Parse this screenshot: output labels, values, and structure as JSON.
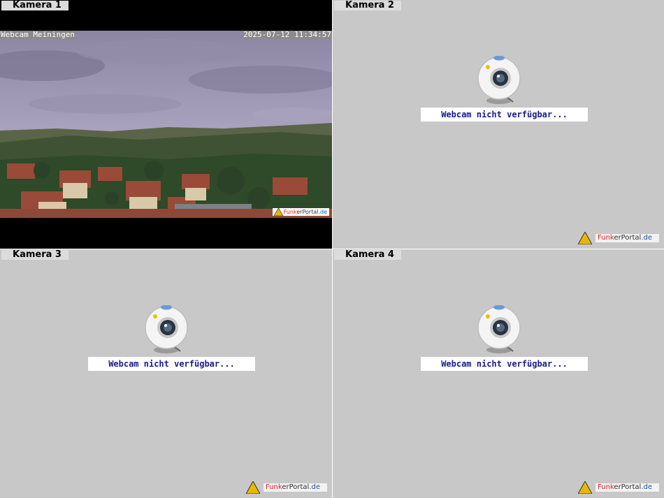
{
  "cameras": [
    {
      "label": "Kamera 1",
      "status": "live",
      "overlay_title": "Webcam Meiningen",
      "overlay_time": "2025-07-12 11:34:57"
    },
    {
      "label": "Kamera 2",
      "status": "unavailable",
      "message": "Webcam nicht verfügbar..."
    },
    {
      "label": "Kamera 3",
      "status": "unavailable",
      "message": "Webcam nicht verfügbar..."
    },
    {
      "label": "Kamera 4",
      "status": "unavailable",
      "message": "Webcam nicht verfügbar..."
    }
  ],
  "brand": {
    "part1": "Funk",
    "part2": "er",
    "part3": "Portal",
    ".de": ".de",
    "suffix": ".de"
  },
  "colors": {
    "panel_bg": "#c8c8c8",
    "message_text": "#1a1a8c",
    "brand_red": "#e0231e",
    "brand_blue": "#1e4fa8"
  }
}
